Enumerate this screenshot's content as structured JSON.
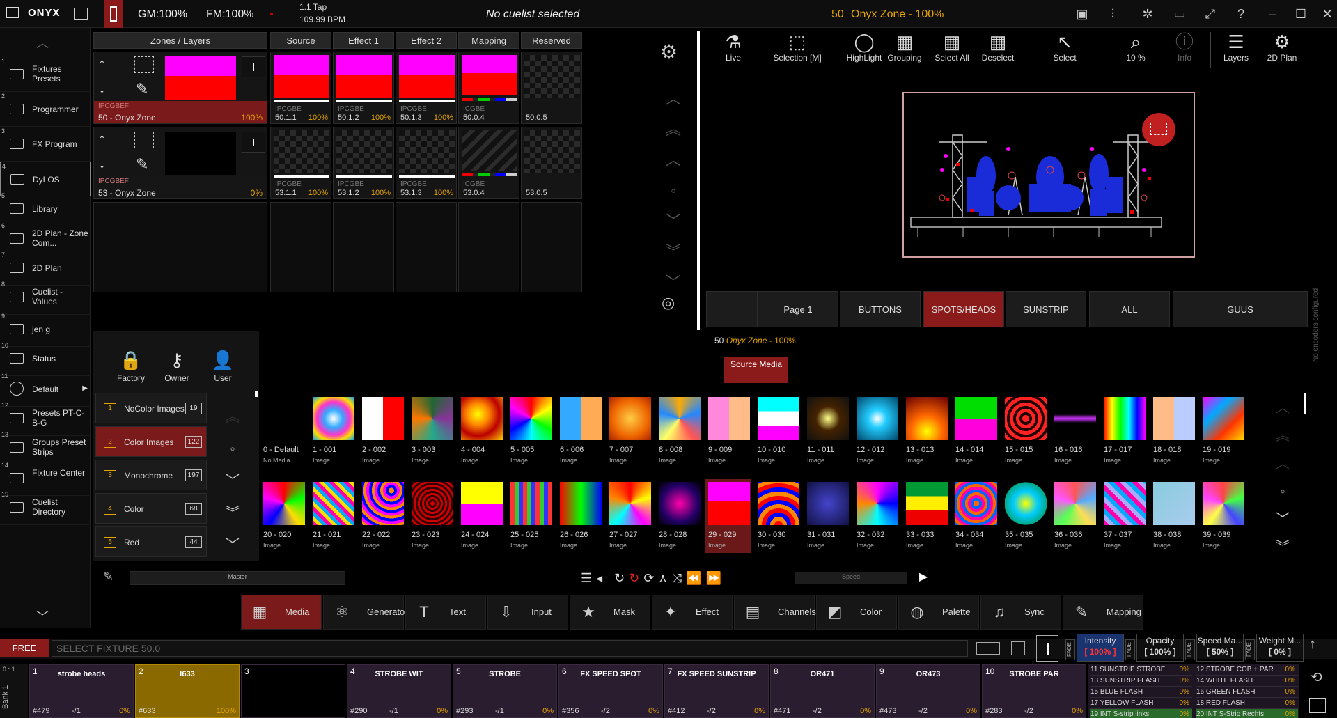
{
  "app": {
    "name": "ONYX",
    "gm": "GM:100%",
    "fm": "FM:100%",
    "tap": "1.1 Tap",
    "bpm": "109.99 BPM",
    "cuelist": "No cuelist selected",
    "zone_num": "50",
    "zone_name": "Onyx Zone - 100%"
  },
  "left_menu": [
    {
      "num": "1",
      "label": "Fixtures Presets"
    },
    {
      "num": "2",
      "label": "Programmer"
    },
    {
      "num": "3",
      "label": "FX Program"
    },
    {
      "num": "4",
      "label": "DyLOS"
    },
    {
      "num": "5",
      "label": "Library"
    },
    {
      "num": "6",
      "label": "2D Plan - Zone Com..."
    },
    {
      "num": "7",
      "label": "2D Plan"
    },
    {
      "num": "8",
      "label": "Cuelist - Values"
    },
    {
      "num": "9",
      "label": "jen g"
    },
    {
      "num": "10",
      "label": "Status"
    },
    {
      "num": "11",
      "label": "Default"
    },
    {
      "num": "12",
      "label": "Presets PT-C-B-G"
    },
    {
      "num": "13",
      "label": "Groups Preset Strips"
    },
    {
      "num": "14",
      "label": "Fixture Center"
    },
    {
      "num": "15",
      "label": "Cuelist Directory"
    }
  ],
  "zones": {
    "headers": [
      "Zones / Layers",
      "Source",
      "Effect 1",
      "Effect 2",
      "Mapping",
      "Reserved"
    ],
    "row1": {
      "tag": "IPCGBEF",
      "name": "50 - Onyx Zone",
      "pct": "100%",
      "cells": [
        {
          "tag": "IPCGBE",
          "id": "50.1.1",
          "pct": "100%"
        },
        {
          "tag": "IPCGBE",
          "id": "50.1.2",
          "pct": "100%"
        },
        {
          "tag": "IPCGBE",
          "id": "50.1.3",
          "pct": "100%"
        },
        {
          "tag": "ICGBE",
          "id": "50.0.4",
          "pct": ""
        },
        {
          "tag": "",
          "id": "50.0.5",
          "pct": ""
        }
      ]
    },
    "row2": {
      "tag": "IPCGBEF",
      "name": "53 - Onyx Zone",
      "pct": "0%",
      "cells": [
        {
          "tag": "IPCGBE",
          "id": "53.1.1",
          "pct": "100%"
        },
        {
          "tag": "IPCGBE",
          "id": "53.1.2",
          "pct": "100%"
        },
        {
          "tag": "IPCGBE",
          "id": "53.1.3",
          "pct": "100%"
        },
        {
          "tag": "ICGBE",
          "id": "53.0.4",
          "pct": ""
        },
        {
          "tag": "",
          "id": "53.0.5",
          "pct": ""
        }
      ]
    }
  },
  "toolbar": [
    {
      "label": "Live",
      "icon": "flask-icon"
    },
    {
      "label": "Selection [M]",
      "icon": "marquee-icon"
    },
    {
      "label": "HighLight",
      "icon": "bulb-icon"
    },
    {
      "label": "Grouping",
      "icon": "grid-icon"
    },
    {
      "label": "Select All",
      "icon": "grid-icon"
    },
    {
      "label": "Deselect",
      "icon": "grid-icon"
    },
    {
      "label": "Select",
      "icon": "cursor-icon"
    },
    {
      "label": "10 %",
      "icon": "zoom-icon"
    },
    {
      "label": "Info",
      "icon": "info-icon"
    },
    {
      "label": "Layers",
      "icon": "layers-icon"
    },
    {
      "label": "2D Plan",
      "icon": "gear-icon"
    }
  ],
  "page_tabs": [
    {
      "label": "Page 1",
      "active": false
    },
    {
      "label": "BUTTONS",
      "active": false
    },
    {
      "label": "SPOTS/HEADS",
      "active": true
    },
    {
      "label": "SUNSTRIP",
      "active": false
    },
    {
      "label": "ALL",
      "active": false
    },
    {
      "label": "GUUS",
      "active": false
    }
  ],
  "encoders_text": "No encoders configured",
  "library": {
    "zone_num": "50",
    "zone_name": "Onyx Zone",
    "zone_pct": "100%",
    "source_btn": "Source Media",
    "owners": [
      {
        "label": "Factory",
        "icon": "lock-icon"
      },
      {
        "label": "Owner",
        "icon": "key-icon"
      },
      {
        "label": "User",
        "icon": "user-icon"
      }
    ],
    "folders": [
      {
        "num": "1",
        "label": "NoColor Images",
        "count": "19"
      },
      {
        "num": "2",
        "label": "Color Images",
        "count": "122",
        "active": true
      },
      {
        "num": "3",
        "label": "Monochrome",
        "count": "197"
      },
      {
        "num": "4",
        "label": "Color",
        "count": "68"
      },
      {
        "num": "5",
        "label": "Red",
        "count": "44"
      }
    ],
    "master_label": "Master",
    "speed_label": "Speed",
    "media": [
      {
        "name": "0 - Default",
        "type": "No Media",
        "bg": "#000"
      },
      {
        "name": "1 - 001",
        "type": "Image",
        "bg": "radial-gradient(circle,#fff,#3af 30%,#f3c 55%,#fd0 75%,#09f)"
      },
      {
        "name": "2 - 002",
        "type": "Image",
        "bg": "linear-gradient(90deg,#fff 0 50%,#f00 50%)"
      },
      {
        "name": "3 - 003",
        "type": "Image",
        "bg": "conic-gradient(#263,#839,#2a8,#f70,#263)"
      },
      {
        "name": "4 - 004",
        "type": "Image",
        "bg": "radial-gradient(circle at 40% 40%,#ff0,#f80 30%,#b00 60%,#fc0)"
      },
      {
        "name": "5 - 005",
        "type": "Image",
        "bg": "conic-gradient(#f00,#ff0,#0f0,#0ff,#00f,#f0f,#f00)"
      },
      {
        "name": "6 - 006",
        "type": "Image",
        "bg": "linear-gradient(90deg,#3af 0 50%,#fa5 50%)"
      },
      {
        "name": "7 - 007",
        "type": "Image",
        "bg": "radial-gradient(circle,#fc4,#e60 60%,#a20)"
      },
      {
        "name": "8 - 008",
        "type": "Image",
        "bg": "conic-gradient(#fa0,#28f,#f55,#ff6,#28f,#fa0)"
      },
      {
        "name": "9 - 009",
        "type": "Image",
        "bg": "linear-gradient(90deg,#f8d 0 50%,#fb8 50%)"
      },
      {
        "name": "10 - 010",
        "type": "Image",
        "bg": "linear-gradient(#0ff 0 33%,#fff 33% 66%,#f0f 66%)"
      },
      {
        "name": "11 - 011",
        "type": "Image",
        "bg": "radial-gradient(circle,#ff8,#420 40%,#111)"
      },
      {
        "name": "12 - 012",
        "type": "Image",
        "bg": "radial-gradient(circle,#fff,#2cf 30%,#046)"
      },
      {
        "name": "13 - 013",
        "type": "Image",
        "bg": "radial-gradient(circle at 50% 80%,#ff0,#f60 40%,#600)"
      },
      {
        "name": "14 - 014",
        "type": "Image",
        "bg": "linear-gradient(#0d0 0 50%,#f0d 50%)"
      },
      {
        "name": "15 - 015",
        "type": "Image",
        "bg": "repeating-radial-gradient(circle,#f22 0 5px,#200 5px 9px)"
      },
      {
        "name": "16 - 016",
        "type": "Image",
        "bg": "linear-gradient(#000 40%,#c3f 50%,#000 60%)"
      },
      {
        "name": "17 - 017",
        "type": "Image",
        "bg": "linear-gradient(90deg,#f00,#ff0,#0f0,#0ff,#00f,#f0f)"
      },
      {
        "name": "18 - 018",
        "type": "Image",
        "bg": "linear-gradient(90deg,#fb8 0 50%,#bcf 50%)"
      },
      {
        "name": "19 - 019",
        "type": "Image",
        "bg": "linear-gradient(135deg,#f0f,#0af,#f30,#fd0)"
      },
      {
        "name": "20 - 020",
        "type": "Image",
        "bg": "conic-gradient(#f00,#0f0,#fd0,#00f,#f0f,#f00)"
      },
      {
        "name": "21 - 021",
        "type": "Image",
        "bg": "repeating-linear-gradient(45deg,#f0a 0 5px,#fd0 5px 10px,#0af 10px 15px)"
      },
      {
        "name": "22 - 022",
        "type": "Image",
        "bg": "repeating-radial-gradient(circle at 70% 20%,#f80 0 4px,#00f 4px 8px,#f0f 8px 12px)"
      },
      {
        "name": "23 - 023",
        "type": "Image",
        "bg": "repeating-radial-gradient(circle,#c00 0 3px,#300 3px 6px)"
      },
      {
        "name": "24 - 024",
        "type": "Image",
        "bg": "linear-gradient(#ff0 0 50%,#f0f 50%)"
      },
      {
        "name": "25 - 025",
        "type": "Image",
        "bg": "repeating-linear-gradient(90deg,#f33 0 6px,#3c3 6px 12px,#33f 12px 18px)"
      },
      {
        "name": "26 - 026",
        "type": "Image",
        "bg": "linear-gradient(90deg,#f00,#0f0,#00f)"
      },
      {
        "name": "27 - 027",
        "type": "Image",
        "bg": "conic-gradient(#f00,#ff0,#f0f,#0ff,#f80,#f00)"
      },
      {
        "name": "28 - 028",
        "type": "Image",
        "bg": "radial-gradient(circle,#f0a,#206 60%,#000)"
      },
      {
        "name": "29 - 029",
        "type": "Image",
        "bg": "linear-gradient(#f0f 0 45%,#f00 45%)"
      },
      {
        "name": "30 - 030",
        "type": "Image",
        "bg": "repeating-radial-gradient(circle at 50% 100%,#f00 0 6px,#f80 6px 12px,#00f 12px 18px)"
      },
      {
        "name": "31 - 031",
        "type": "Image",
        "bg": "radial-gradient(circle,#44c,#114)"
      },
      {
        "name": "32 - 032",
        "type": "Image",
        "bg": "conic-gradient(#f0f,#00f,#0ff,#f80,#f0f)"
      },
      {
        "name": "33 - 033",
        "type": "Image",
        "bg": "linear-gradient(#093 0 33%,#fe0 33% 66%,#e00 66%)"
      },
      {
        "name": "34 - 034",
        "type": "Image",
        "bg": "repeating-radial-gradient(circle,#f60 0 4px,#06f 4px 8px,#f0a 8px 12px)"
      },
      {
        "name": "35 - 035",
        "type": "Image",
        "bg": "radial-gradient(circle,#ff0,#0cf 40%,#0a8 70%,#000 72%)"
      },
      {
        "name": "36 - 036",
        "type": "Image",
        "bg": "conic-gradient(#f55,#5af,#fd5,#5f5,#f5f,#f55)"
      },
      {
        "name": "37 - 037",
        "type": "Image",
        "bg": "repeating-linear-gradient(45deg,#f0a 0 6px,#aaf 6px 12px,#0af 12px 18px)"
      },
      {
        "name": "38 - 038",
        "type": "Image",
        "bg": "linear-gradient(135deg,#8cd,#ace)"
      },
      {
        "name": "39 - 039",
        "type": "Image",
        "bg": "conic-gradient(#f44,#4f4,#44f,#ff4,#f4f,#f44)"
      }
    ]
  },
  "bottom_tools": [
    {
      "label": "Media",
      "icon": "media-icon",
      "active": true
    },
    {
      "label": "Generator",
      "icon": "atom-icon"
    },
    {
      "label": "Text",
      "icon": "text-icon"
    },
    {
      "label": "Input",
      "icon": "input-icon"
    },
    {
      "label": "Mask",
      "icon": "mask-icon"
    },
    {
      "label": "Effect",
      "icon": "wand-icon"
    },
    {
      "label": "Channels",
      "icon": "channels-icon"
    },
    {
      "label": "Color",
      "icon": "color-icon"
    },
    {
      "label": "Palette",
      "icon": "palette-icon"
    },
    {
      "label": "Sync",
      "icon": "sync-icon"
    },
    {
      "label": "Mapping",
      "icon": "mapping-icon"
    }
  ],
  "command": {
    "free": "FREE",
    "placeholder": "SELECT FIXTURE 50.0"
  },
  "attrs": [
    {
      "side": "FADE",
      "label": "Intensity",
      "value": "[ 100% ]",
      "active": true
    },
    {
      "side": "FADE",
      "label": "Opacity",
      "value": "[ 100% ]"
    },
    {
      "side": "FADE",
      "label": "Speed Ma...",
      "value": "[ 50% ]"
    },
    {
      "side": "FADE",
      "label": "Weight M...",
      "value": "[ 0% ]"
    }
  ],
  "bank": {
    "label": "0 : 1",
    "name": "Bank 1"
  },
  "playbacks": [
    {
      "num": "1",
      "name": "strobe heads",
      "id": "#479",
      "mid": "-/1",
      "pct": "0%"
    },
    {
      "num": "2",
      "name": "I633",
      "id": "#633",
      "mid": "",
      "pct": "100%",
      "active": true
    },
    {
      "num": "3",
      "name": "",
      "id": "",
      "mid": "",
      "pct": ""
    },
    {
      "num": "4",
      "name": "STROBE WIT",
      "id": "#290",
      "mid": "-/1",
      "pct": "0%"
    },
    {
      "num": "5",
      "name": "STROBE",
      "id": "#293",
      "mid": "-/1",
      "pct": "0%"
    },
    {
      "num": "6",
      "name": "FX SPEED SPOT",
      "id": "#356",
      "mid": "-/2",
      "pct": "0%"
    },
    {
      "num": "7",
      "name": "FX SPEED SUNSTRIP",
      "id": "#412",
      "mid": "-/2",
      "pct": "0%"
    },
    {
      "num": "8",
      "name": "OR471",
      "id": "#471",
      "mid": "-/2",
      "pct": "0%"
    },
    {
      "num": "9",
      "name": "OR473",
      "id": "#473",
      "mid": "-/2",
      "pct": "0%"
    },
    {
      "num": "10",
      "name": "STROBE PAR",
      "id": "#283",
      "mid": "-/2",
      "pct": "0%"
    }
  ],
  "small_playbacks": [
    {
      "name": "11 SUNSTRIP STROBE",
      "pct": "0%"
    },
    {
      "name": "12 STROBE COB + PAR",
      "pct": "0%"
    },
    {
      "name": "13 SUNSTRIP FLASH",
      "pct": "0%"
    },
    {
      "name": "14 WHITE FLASH",
      "pct": "0%"
    },
    {
      "name": "15 BLUE FLASH",
      "pct": "0%"
    },
    {
      "name": "16 GREEN FLASH",
      "pct": "0%"
    },
    {
      "name": "17 YELLOW FLASH",
      "pct": "0%"
    },
    {
      "name": "18 RED FLASH",
      "pct": "0%"
    },
    {
      "name": "19 INT S-strip links",
      "pct": "0%"
    },
    {
      "name": "20 INT S-Strip Rechts",
      "pct": "0%"
    }
  ],
  "colors": {
    "accent": "#e6a400",
    "active_red": "#8b1a1a",
    "magenta": "#ff00ff",
    "playback": "#2a1d30",
    "playback_active": "#8a6a00"
  }
}
